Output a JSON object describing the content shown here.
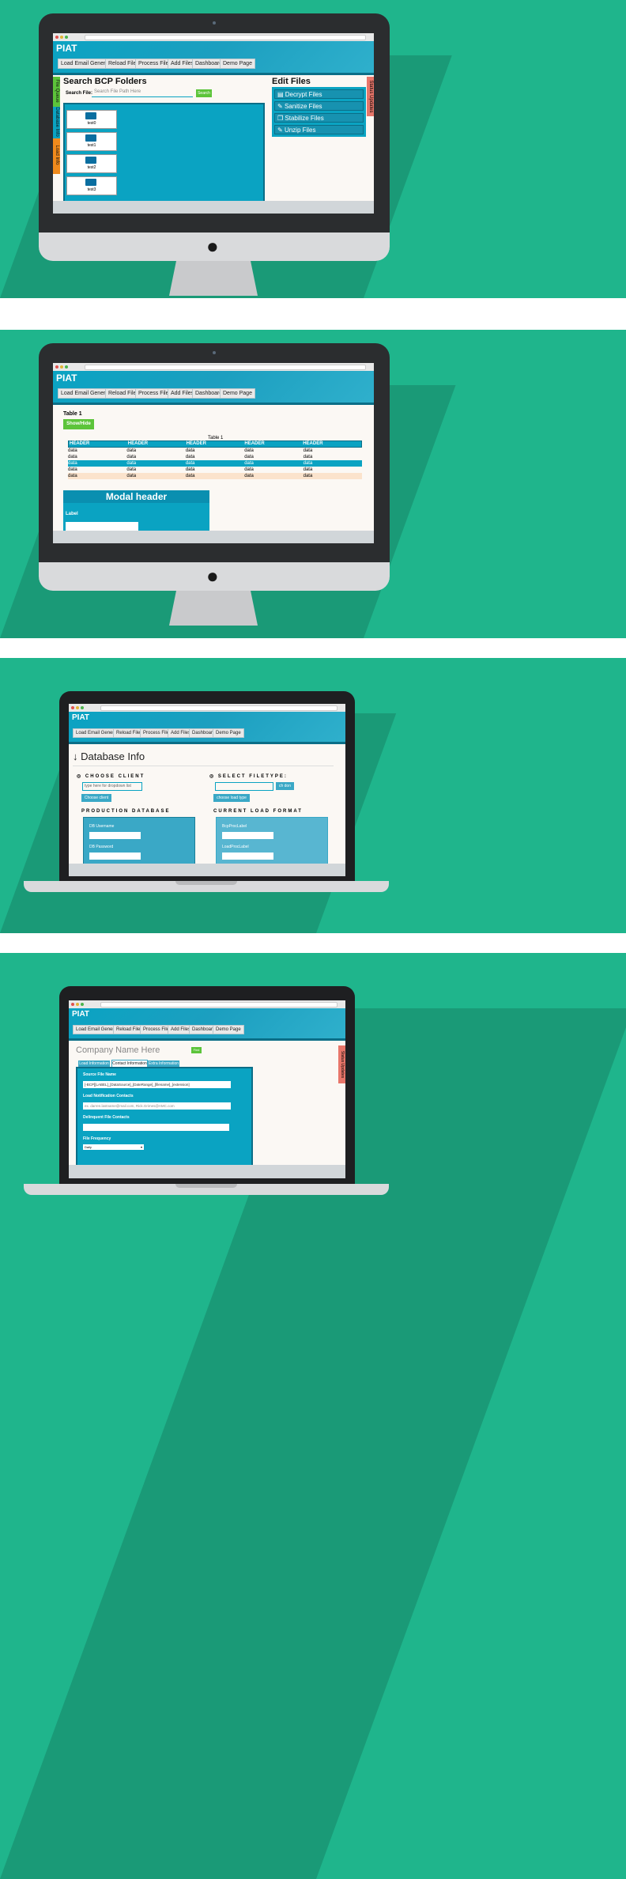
{
  "app": {
    "title": "PIAT"
  },
  "nav": [
    "Load Email Generator",
    "Reload Files",
    "Process Files",
    "Add Files",
    "Dashboard",
    "Demo Page"
  ],
  "screen1": {
    "side_tabs": [
      "File Queue",
      "Database Info",
      "Load Info"
    ],
    "search_title": "Search BCP Folders",
    "search_label": "Search File:",
    "search_placeholder": "Search File Path Here",
    "search_button": "Search",
    "folders": [
      "test0",
      "test1",
      "test2",
      "test3"
    ],
    "edit_title": "Edit Files",
    "edit_items": [
      "Decrypt Files",
      "Sanitize Files",
      "Stabilize Files",
      "Unzip Files"
    ],
    "status_tab": "Status Updates"
  },
  "screen2": {
    "table_heading": "Table 1",
    "showhide": "Show/Hide",
    "table_caption": "Table 1",
    "headers": [
      "HEADER",
      "HEADER",
      "HEADER",
      "HEADER",
      "HEADER"
    ],
    "rows": [
      [
        "data",
        "data",
        "data",
        "data",
        "data"
      ],
      [
        "data",
        "data",
        "data",
        "data",
        "data"
      ],
      [
        "data",
        "data",
        "data",
        "data",
        "data"
      ],
      [
        "data",
        "data",
        "data",
        "data",
        "data"
      ],
      [
        "data",
        "data",
        "data",
        "data",
        "data"
      ]
    ],
    "modal_header": "Modal header",
    "modal_label": "Label"
  },
  "screen3": {
    "page_title": "Database Info",
    "choose_client_title": "CHOOSE CLIENT",
    "client_placeholder": "type here for dropdown list",
    "choose_client_button": "Choose client",
    "filetype_title": "SELECT FILETYPE:",
    "filetype_button": "ch don",
    "choose_load_type": "choose load type",
    "prod_db_title": "PRODUCTION DATABASE",
    "db_username": "DB Username",
    "db_password": "DB Password",
    "load_format_title": "CURRENT LOAD FORMAT",
    "bcp_label": "BcpProcLabel",
    "load_label": "LoadProcLabel"
  },
  "screen4": {
    "company": "Company Name Here",
    "find": "Find",
    "tabs": [
      "Load Information",
      "Contact Information",
      "Extra Information"
    ],
    "source_label": "Source File Name",
    "source_value": "[-BCP][LABEL]_[DataSource]_[DateRange]_[filename]_[extension]",
    "notify_label": "Load Notification Contacts",
    "notify_value": "ex. darren.lastname@mail.com, Rick.Grimes@AMC.com",
    "delinquent_label": "Delinquent File Contacts",
    "frequency_label": "File Frequency",
    "frequency_value": "Daily",
    "status_tab": "Status Updates"
  },
  "colors": {
    "background": "#1fb58c",
    "primary": "#0aa3c2",
    "dark": "#0b6e87",
    "green": "#5cc43a",
    "orange": "#f08a1c"
  }
}
